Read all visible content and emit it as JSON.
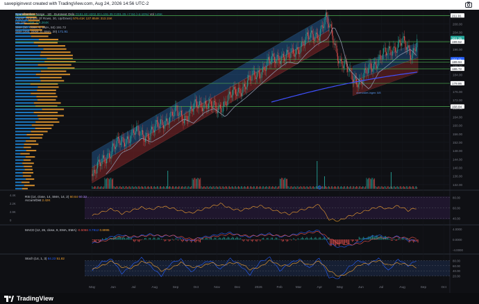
{
  "caption": "savepiginvest created with TradingView.com, Aug 24, 2026 14:56 UTC-2",
  "brand": "TradingView",
  "legend": {
    "symbol": "Spareibanken Norge · 1D · Euronext Oslo",
    "ohlc": "O191.60 H202.00 L191.35 C201.25 +7.94 (+4.10%)",
    "vol_label": "Vol",
    "vol_value": "145K",
    "vwap_label": "VWAP (Number Of Rows, 30, Up/Down)",
    "vwap_values": "576.41K 137.854K 313.15K",
    "vol20_label": "Vol (20)",
    "vol20_values": "145K 116.264K",
    "sma50_label": "SMA (50, close, 0, SMA, 50)",
    "sma50_value": "191.72",
    "sma200_label": "SMA (200, close, 0, SMA, 20)",
    "sma200_value": "171.91"
  },
  "rsi_legend": {
    "label": "RSI (14, close, 14, SMA, 14, 2)",
    "v1": "60.64",
    "v2": "60.33",
    "label2": "Accum/Dist",
    "v3": "2.42K"
  },
  "macd_legend": {
    "label": "MACD (12, 26, close, 9, EMA, EMA)",
    "v1": "-0.5066",
    "v2": "0.7812",
    "v3": "0.8995"
  },
  "stoch_legend": {
    "label": "Stoch (14, 1, 3)",
    "v1": "84.23",
    "v2": "51.82"
  },
  "colors": {
    "up": "#26a69a",
    "down": "#ef5350",
    "profile_up": "#2196f3",
    "profile_down": "#f7a531",
    "channel_up": "#2a78c9",
    "channel_down": "#b22d2d",
    "green_line": "#4caf50",
    "sma50": "#8b93a8",
    "sma200": "#3f51ff"
  },
  "chart_data": [
    {
      "type": "line",
      "title": "Spareibanken Norge · 1D · Euronext Oslo",
      "x_ticks": [
        "May",
        "Jun",
        "Jul",
        "Aug",
        "Sep",
        "Oct",
        "Nov",
        "Dec",
        "2026",
        "Feb",
        "Mar",
        "Apr",
        "May",
        "Jun",
        "Jul",
        "Aug",
        "Sep",
        "Oct"
      ],
      "y_ticks": [
        132,
        136,
        140,
        144,
        148,
        152,
        156,
        160,
        164,
        168,
        172,
        176,
        180,
        184,
        188,
        192,
        196,
        200,
        204,
        208,
        212
      ],
      "ylim": [
        130,
        214
      ],
      "series": [
        {
          "name": "Close",
          "x": [
            "2025-05-01",
            "2025-05-15",
            "2025-06-01",
            "2025-06-15",
            "2025-07-01",
            "2025-07-15",
            "2025-08-01",
            "2025-08-15",
            "2025-09-01",
            "2025-09-15",
            "2025-10-01",
            "2025-10-15",
            "2025-11-01",
            "2025-11-15",
            "2025-12-01",
            "2025-12-15",
            "2026-01-01",
            "2026-01-15",
            "2026-02-01",
            "2026-02-15",
            "2026-03-01",
            "2026-03-15",
            "2026-04-01",
            "2026-04-10",
            "2026-04-20",
            "2026-05-01",
            "2026-05-15",
            "2026-06-01",
            "2026-06-15",
            "2026-07-01",
            "2026-07-15",
            "2026-08-01",
            "2026-08-15",
            "2026-08-24"
          ],
          "values": [
            137,
            142,
            150,
            152,
            157,
            155,
            158,
            162,
            166,
            164,
            169,
            171,
            167,
            172,
            176,
            180,
            185,
            189,
            193,
            192,
            197,
            201,
            204,
            210,
            203,
            190,
            185,
            180,
            188,
            192,
            196,
            199,
            194,
            201.25
          ]
        }
      ],
      "price_labels": [
        "211.91",
        "201.25",
        "199.52",
        "191.21",
        "189.94",
        "186.72",
        "179.86",
        "168.84"
      ],
      "annotation": "overvoldet-ingen: 8/8"
    },
    {
      "type": "line",
      "title": "RSI (14, close, 14, SMA, 14, 2)",
      "y_ticks": [
        80,
        60,
        40
      ],
      "right_ticks": [
        "80.00",
        "60.00",
        "40.00"
      ],
      "left_ticks": [
        "4.4K",
        "2.2K",
        "2.9K",
        "0"
      ],
      "series": [
        {
          "name": "RSI",
          "values": [
            45,
            52,
            58,
            49,
            55,
            61,
            57,
            63,
            60,
            54,
            50,
            56,
            62,
            68,
            59,
            55,
            60,
            64,
            58,
            52,
            48,
            55,
            60,
            66,
            38,
            35,
            44,
            50,
            56,
            62,
            58,
            64,
            55,
            60.64
          ]
        }
      ]
    },
    {
      "type": "line",
      "title": "MACD (12, 26, close, 9, EMA, EMA)",
      "y_ticks": [
        4,
        0,
        -4
      ],
      "right_ticks": [
        "4.0000",
        "0.0000",
        "-4.0000"
      ],
      "series": [
        {
          "name": "MACD",
          "values": [
            -1.5,
            -0.5,
            1.2,
            1.8,
            0.6,
            1.5,
            2.0,
            1.1,
            1.6,
            0.4,
            -0.5,
            0.8,
            1.3,
            2.1,
            2.6,
            1.4,
            0.9,
            1.8,
            2.2,
            1.0,
            1.5,
            2.4,
            3.0,
            3.4,
            -1.6,
            -3.0,
            -2.4,
            -1.0,
            0.8,
            1.6,
            0.5,
            1.2,
            -0.3,
            -0.51
          ]
        },
        {
          "name": "Signal",
          "values": [
            -1.0,
            -0.8,
            0.3,
            1.2,
            1.1,
            1.2,
            1.6,
            1.4,
            1.5,
            0.9,
            0.2,
            0.4,
            0.9,
            1.5,
            2.0,
            1.7,
            1.3,
            1.5,
            1.8,
            1.4,
            1.4,
            1.9,
            2.5,
            2.9,
            0.5,
            -1.5,
            -2.0,
            -1.6,
            -0.5,
            0.6,
            0.6,
            0.9,
            0.4,
            0.78
          ]
        }
      ]
    },
    {
      "type": "line",
      "title": "Stoch (14, 1, 3)",
      "y_ticks": [
        80,
        60,
        40,
        20
      ],
      "right_ticks": [
        "80.00",
        "60.00",
        "40.00",
        "20.00"
      ],
      "series": [
        {
          "name": "%K",
          "values": [
            40,
            75,
            85,
            30,
            60,
            90,
            55,
            20,
            70,
            85,
            35,
            65,
            80,
            45,
            88,
            60,
            25,
            75,
            92,
            40,
            70,
            85,
            50,
            90,
            15,
            10,
            55,
            80,
            65,
            90,
            40,
            85,
            60,
            84.23
          ]
        },
        {
          "name": "%D",
          "values": [
            45,
            60,
            78,
            55,
            50,
            75,
            70,
            40,
            50,
            72,
            55,
            55,
            72,
            60,
            70,
            70,
            45,
            55,
            80,
            62,
            60,
            78,
            62,
            78,
            40,
            18,
            32,
            62,
            70,
            80,
            62,
            70,
            64,
            51.82
          ]
        }
      ]
    }
  ]
}
